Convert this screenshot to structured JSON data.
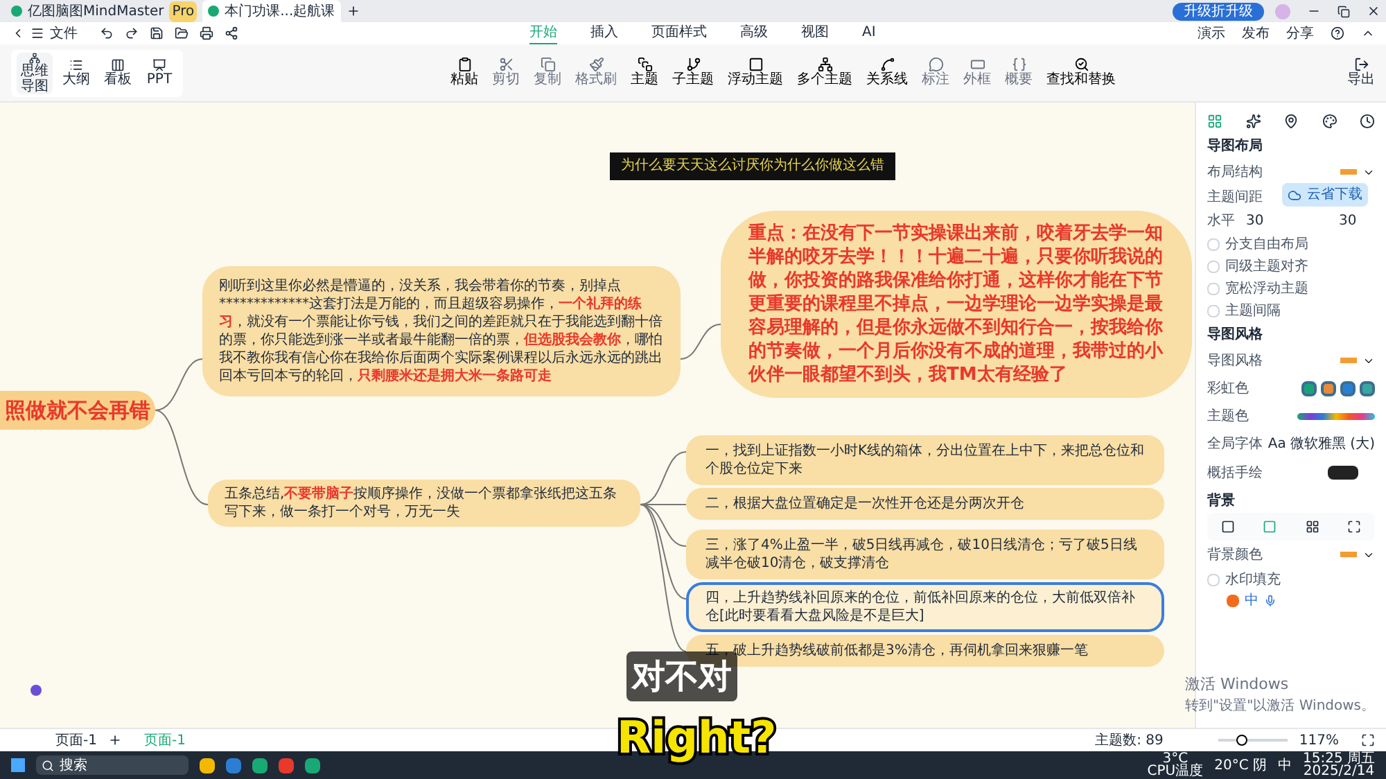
{
  "title_bar": {
    "tabs": [
      {
        "label": "亿图脑图MindMaster",
        "badge": "Pro",
        "selected": false
      },
      {
        "label": "本门功课...起航课",
        "selected": true
      }
    ],
    "upgrade": "升级折升级"
  },
  "menu_bar": {
    "file": "文件",
    "ribbon_tabs": [
      {
        "label": "开始",
        "selected": true
      },
      {
        "label": "插入",
        "selected": false
      },
      {
        "label": "页面样式",
        "selected": false
      },
      {
        "label": "高级",
        "selected": false
      },
      {
        "label": "视图",
        "selected": false
      },
      {
        "label": "AI",
        "selected": false
      }
    ],
    "actions": [
      "演示",
      "发布",
      "分享"
    ]
  },
  "view_modes": [
    {
      "label": "思维导图",
      "selected": true
    },
    {
      "label": "大纲",
      "selected": false
    },
    {
      "label": "看板",
      "selected": false
    },
    {
      "label": "PPT",
      "selected": false
    }
  ],
  "ribbon": [
    {
      "kind": "paste",
      "label": "粘贴",
      "disabled": false
    },
    {
      "kind": "cut",
      "label": "剪切",
      "disabled": true
    },
    {
      "kind": "copy",
      "label": "复制",
      "disabled": true
    },
    {
      "kind": "brush",
      "label": "格式刷",
      "disabled": true
    },
    {
      "kind": "topic",
      "label": "主题",
      "disabled": false
    },
    {
      "kind": "subtopic",
      "label": "子主题",
      "disabled": false
    },
    {
      "kind": "float",
      "label": "浮动主题",
      "disabled": false
    },
    {
      "kind": "multi",
      "label": "多个主题",
      "disabled": false
    },
    {
      "kind": "relation",
      "label": "关系线",
      "disabled": false
    },
    {
      "kind": "callout",
      "label": "标注",
      "disabled": true
    },
    {
      "kind": "frame",
      "label": "外框",
      "disabled": true
    },
    {
      "kind": "summary",
      "label": "概要",
      "disabled": true
    },
    {
      "kind": "find",
      "label": "查找和替换",
      "disabled": false
    }
  ],
  "export": "导出",
  "canvas": {
    "root": "照做就不会再错",
    "title": "为什么要天天这么讨厌你为什么你做这么错",
    "intro": [
      {
        "text": "刚听到这里你必然是懵逼的，没关系，我会带着你的节奏，别掉点*************这套打法是万能的，而且超级容易操作，",
        "highlight": false
      },
      {
        "text": "一个礼拜的练习",
        "highlight": true
      },
      {
        "text": "，就没有一个票能让你亏钱，我们之间的差距就只在于我能选到翻十倍的票，你只能选到涨一半或者最牛能翻一倍的票，",
        "highlight": false
      },
      {
        "text": "但选股我会教你",
        "highlight": true
      },
      {
        "text": "，哪怕我不教你我有信心你在我给你后面两个实际案例课程以后永远永远的跳出回本亏回本亏的轮回，",
        "highlight": false
      },
      {
        "text": "只剩腰米还是拥大米一条路可走",
        "highlight": true
      }
    ],
    "key_point": "重点：在没有下一节实操课出来前，咬着牙去学一知半解的咬牙去学！！！十遍二十遍，只要你听我说的做，你投资的路我保准给你打通，这样你才能在下节更重要的课程里不掉点，一边学理论一边学实操是最容易理解的，但是你永远做不到知行合一，按我给你的节奏做，一个月后你没有不成的道理，我带过的小伙伴一眼都望不到头，我TM太有经验了",
    "summary": [
      {
        "text": "五条总结,",
        "highlight": false
      },
      {
        "text": "不要带脑子",
        "highlight": true
      },
      {
        "text": "按顺序操作，没做一个票都拿张纸把这五条写下来，做一条打一个对号，万无一失",
        "highlight": false
      }
    ],
    "steps": [
      {
        "text": "一，找到上证指数一小时K线的箱体，分出位置在上中下，来把总仓位和个股仓位定下来",
        "selected": false
      },
      {
        "text": "二，根据大盘位置确定是一次性开仓还是分两次开仓",
        "selected": false
      },
      {
        "text": "三，涨了4%止盈一半，破5日线再减仓，破10日线清仓；亏了破5日线减半仓破10清仓，破支撑清仓",
        "selected": false
      },
      {
        "text": "四，上升趋势线补回原来的仓位，前低补回原来的仓位，大前低双倍补仓[此时要看看大盘风险是不是巨大]",
        "selected": true
      },
      {
        "text": "五，破上升趋势线破前低都是3%清仓，再伺机拿回来狠赚一笔",
        "selected": false
      }
    ]
  },
  "panel": {
    "sections": [
      {
        "title": "导图布局",
        "rows": [
          {
            "kind": "select",
            "label": "布局结构"
          },
          {
            "kind": "label",
            "label": "主题间距"
          },
          {
            "kind": "spacing",
            "label": "水平",
            "value": "30",
            "value2": "30"
          },
          {
            "kind": "check",
            "label": "分支自由布局",
            "checked": false
          },
          {
            "kind": "check",
            "label": "同级主题对齐",
            "checked": false
          },
          {
            "kind": "check",
            "label": "宽松浮动主题",
            "checked": false
          },
          {
            "kind": "check",
            "label": "主题间隔",
            "checked": false
          }
        ]
      },
      {
        "title": "导图风格",
        "rows": [
          {
            "kind": "select",
            "label": "导图风格"
          },
          {
            "kind": "swatches",
            "label": "彩虹色"
          },
          {
            "kind": "palette",
            "label": "主题色"
          },
          {
            "kind": "font",
            "label": "全局字体",
            "value": "Aa 微软雅黑 (大)"
          },
          {
            "kind": "color",
            "label": "概括手绘"
          }
        ]
      },
      {
        "title": "背景",
        "rows": [
          {
            "kind": "bgicons",
            "label": ""
          },
          {
            "kind": "select",
            "label": "背景颜色"
          },
          {
            "kind": "check",
            "label": "水印填充",
            "checked": false
          }
        ]
      }
    ]
  },
  "cloud_popup": "云省下载",
  "ime": "中",
  "activation": {
    "title": "激活 Windows",
    "hint": "转到\"设置\"以激活 Windows。"
  },
  "status_bar": {
    "page_select": "页面-1",
    "page_tab": "页面-1",
    "topic_count": "主题数: 89",
    "zoom": "117%",
    "zoom_slider": {
      "level": 0.3
    }
  },
  "subtitles": [
    "对不对",
    "Right?"
  ],
  "taskbar": {
    "search": "搜索",
    "cpu_temp": "3°C",
    "cpu_label": "CPU温度",
    "weather": "20°C 阴",
    "ime": "中",
    "time": "15:25 周五",
    "date": "2025/2/14"
  }
}
